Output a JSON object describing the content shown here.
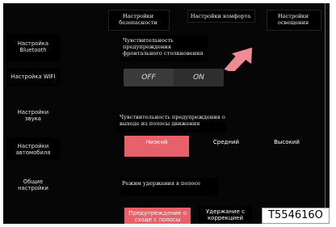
{
  "tabs": [
    {
      "label": "Настройки безопасности"
    },
    {
      "label": "Настройки комфорта"
    },
    {
      "label": "Настройки освещения"
    }
  ],
  "sidebar": {
    "items": [
      {
        "label": "Настройка Bluetooth"
      },
      {
        "label": "Настройка WIFI"
      },
      {
        "label": "Настройки звука"
      },
      {
        "label": "Настройки автомобиля"
      },
      {
        "label": "Общие настройки"
      }
    ]
  },
  "frontal_collision": {
    "title": "Чувствительность предупреждения фронтального столкновения",
    "off_label": "OFF",
    "on_label": "ON",
    "selected": "OFF"
  },
  "lane_departure": {
    "title": "Чувствительность предупреждения о выходе из полосы движения",
    "options": [
      {
        "label": "Низкий",
        "selected": true
      },
      {
        "label": "Средний",
        "selected": false
      },
      {
        "label": "Высокий",
        "selected": false
      }
    ]
  },
  "lane_keeping": {
    "title": "Режим удержания в полосе",
    "options": [
      {
        "label": "Предупреждение о сходе с полосы",
        "selected": true
      },
      {
        "label": "Удержание с коррекцией",
        "selected": false
      }
    ]
  },
  "figure_code": "T554616O",
  "colors": {
    "accent": "#e8616a",
    "background": "#060606",
    "toggle": "#2e2e2e",
    "arrow": "#f08a94"
  },
  "icons": {
    "pointer": "arrow-pointer-icon"
  }
}
